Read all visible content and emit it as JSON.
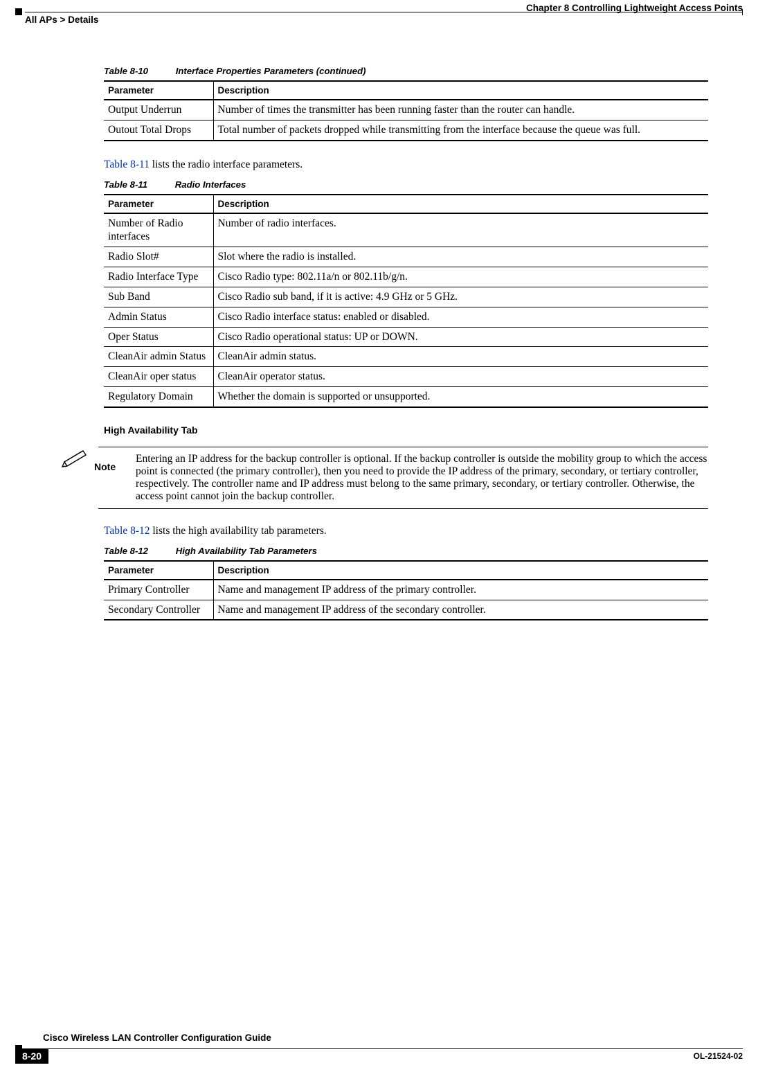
{
  "header": {
    "chapter_label": "Chapter 8      Controlling Lightweight Access Points",
    "breadcrumb": "All APs > Details"
  },
  "table810": {
    "caption_num": "Table 8-10",
    "caption_title": "Interface Properties Parameters  (continued)",
    "col_param": "Parameter",
    "col_desc": "Description",
    "rows": [
      {
        "param": "Output Underrun",
        "desc": "Number of times the transmitter has been running faster than the router can handle."
      },
      {
        "param": "Outout Total Drops",
        "desc": "Total number of packets dropped while transmitting from the interface because the queue was full."
      }
    ]
  },
  "para_811_pre_link": "",
  "para_811_link": "Table 8-11",
  "para_811_post": " lists the radio interface parameters.",
  "table811": {
    "caption_num": "Table 8-11",
    "caption_title": "Radio Interfaces",
    "col_param": "Parameter",
    "col_desc": "Description",
    "rows": [
      {
        "param": "Number of Radio interfaces",
        "desc": "Number of radio interfaces."
      },
      {
        "param": "Radio Slot#",
        "desc": "Slot where the radio is installed."
      },
      {
        "param": "Radio Interface Type",
        "desc": "Cisco Radio type: 802.11a/n or 802.11b/g/n."
      },
      {
        "param": "Sub Band",
        "desc": "Cisco Radio sub band, if it is active: 4.9 GHz or 5 GHz."
      },
      {
        "param": "Admin Status",
        "desc": "Cisco Radio interface status: enabled or disabled."
      },
      {
        "param": "Oper Status",
        "desc": "Cisco Radio operational status: UP or DOWN."
      },
      {
        "param": "CleanAir admin Status",
        "desc": "CleanAir admin status."
      },
      {
        "param": "CleanAir oper status",
        "desc": "CleanAir operator status."
      },
      {
        "param": "Regulatory Domain",
        "desc": "Whether the domain is supported or unsupported."
      }
    ]
  },
  "ha_heading": "High Availability Tab",
  "note": {
    "label": "Note",
    "body": "Entering an IP address for the backup controller is optional. If the backup controller is outside the mobility group to which the access point is connected (the primary controller), then you need to provide the IP address of the primary, secondary, or tertiary controller, respectively. The controller name and IP address must belong to the same primary, secondary, or tertiary controller. Otherwise, the access point cannot join the backup controller."
  },
  "para_812_link": "Table 8-12",
  "para_812_post": " lists the high availability tab parameters.",
  "table812": {
    "caption_num": "Table 8-12",
    "caption_title": "High Availability Tab Parameters",
    "col_param": "Parameter",
    "col_desc": "Description",
    "rows": [
      {
        "param": "Primary Controller",
        "desc": "Name and management IP address of the primary controller."
      },
      {
        "param": "Secondary Controller",
        "desc": "Name and management IP address of the secondary controller."
      }
    ]
  },
  "footer": {
    "book_title": "Cisco Wireless LAN Controller Configuration Guide",
    "page_num": "8-20",
    "doc_id": "OL-21524-02"
  }
}
